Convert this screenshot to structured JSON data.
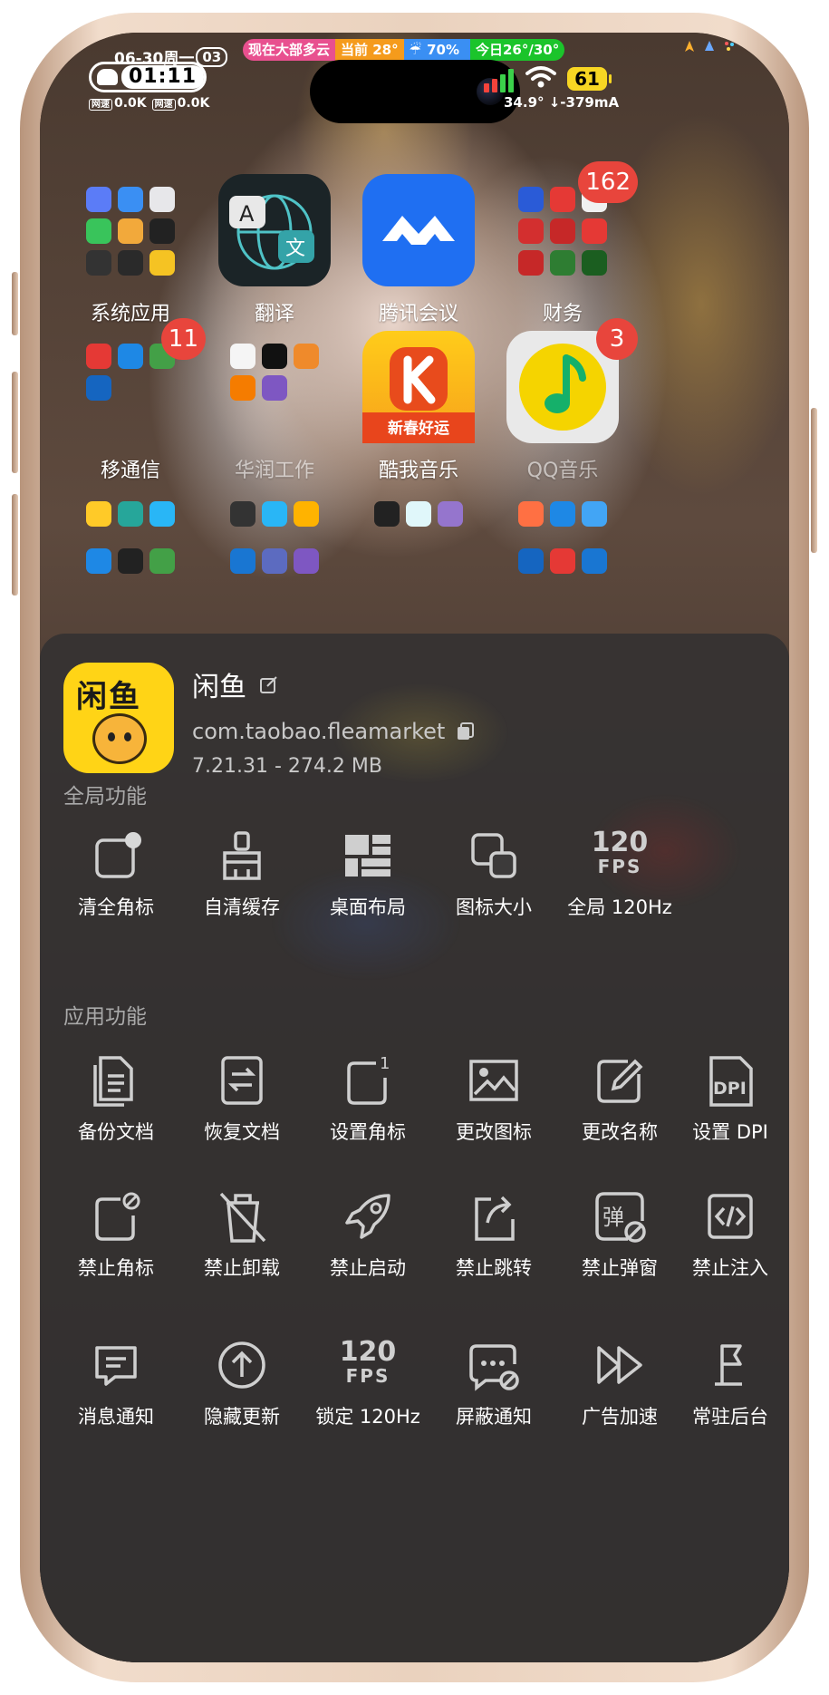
{
  "status_bar": {
    "date": "06-30周一",
    "day_badge": "03",
    "weather": [
      "现在大部多云",
      "当前 28°",
      "70%",
      "今日26°/30°"
    ],
    "time": "01:11",
    "net_tag": "网速",
    "net_down": "0.0K",
    "net_up": "0.0K",
    "battery": "61",
    "temperature_current": "34.9° ↓-379mA"
  },
  "home": {
    "apps": [
      {
        "label": "系统应用"
      },
      {
        "label": "翻译"
      },
      {
        "label": "腾讯会议"
      },
      {
        "label": "财务",
        "badge": "162"
      },
      {
        "label": "移通信",
        "badge": "11"
      },
      {
        "label": "华润工作"
      },
      {
        "label": "酷我音乐",
        "subtext": "新春好运"
      },
      {
        "label": "QQ音乐",
        "badge": "3"
      }
    ]
  },
  "sheet": {
    "app_icon_text": "闲鱼",
    "app_name": "闲鱼",
    "package": "com.taobao.fleamarket",
    "version": "7.21.31 - 274.2 MB",
    "global_title": "全局功能",
    "global_items": [
      {
        "label": "清全角标",
        "icon": "badge-clear-icon"
      },
      {
        "label": "自清缓存",
        "icon": "broom-icon"
      },
      {
        "label": "桌面布局",
        "icon": "layout-grid-icon"
      },
      {
        "label": "图标大小",
        "icon": "icon-size-icon"
      },
      {
        "label": "全局 120Hz",
        "icon": "fps-120-icon"
      }
    ],
    "app_title": "应用功能",
    "app_items": [
      {
        "label": "备份文档",
        "icon": "document-backup-icon"
      },
      {
        "label": "恢复文档",
        "icon": "document-restore-icon"
      },
      {
        "label": "设置角标",
        "icon": "set-badge-icon"
      },
      {
        "label": "更改图标",
        "icon": "image-icon"
      },
      {
        "label": "更改名称",
        "icon": "edit-icon"
      },
      {
        "label": "设置 DPI",
        "icon": "dpi-icon"
      },
      {
        "label": "禁止角标",
        "icon": "badge-block-icon"
      },
      {
        "label": "禁止卸载",
        "icon": "uninstall-block-icon"
      },
      {
        "label": "禁止启动",
        "icon": "rocket-icon"
      },
      {
        "label": "禁止跳转",
        "icon": "redirect-block-icon"
      },
      {
        "label": "禁止弹窗",
        "icon": "popup-block-icon"
      },
      {
        "label": "禁止注入",
        "icon": "code-icon"
      },
      {
        "label": "消息通知",
        "icon": "message-icon"
      },
      {
        "label": "隐藏更新",
        "icon": "update-icon"
      },
      {
        "label": "锁定 120Hz",
        "icon": "fps-120-icon"
      },
      {
        "label": "屏蔽通知",
        "icon": "notification-block-icon"
      },
      {
        "label": "广告加速",
        "icon": "fast-forward-icon"
      },
      {
        "label": "常驻后台",
        "icon": "flag-icon"
      }
    ],
    "fps_number": "120",
    "fps_unit": "FPS",
    "dpi_text": "DPI",
    "popup_char": "弹"
  },
  "colors": {
    "sheet_bg": "#343232",
    "badge_red": "#e8453c",
    "icon_stroke": "#cfcfcf",
    "xianyu_yellow": "#ffd416"
  }
}
